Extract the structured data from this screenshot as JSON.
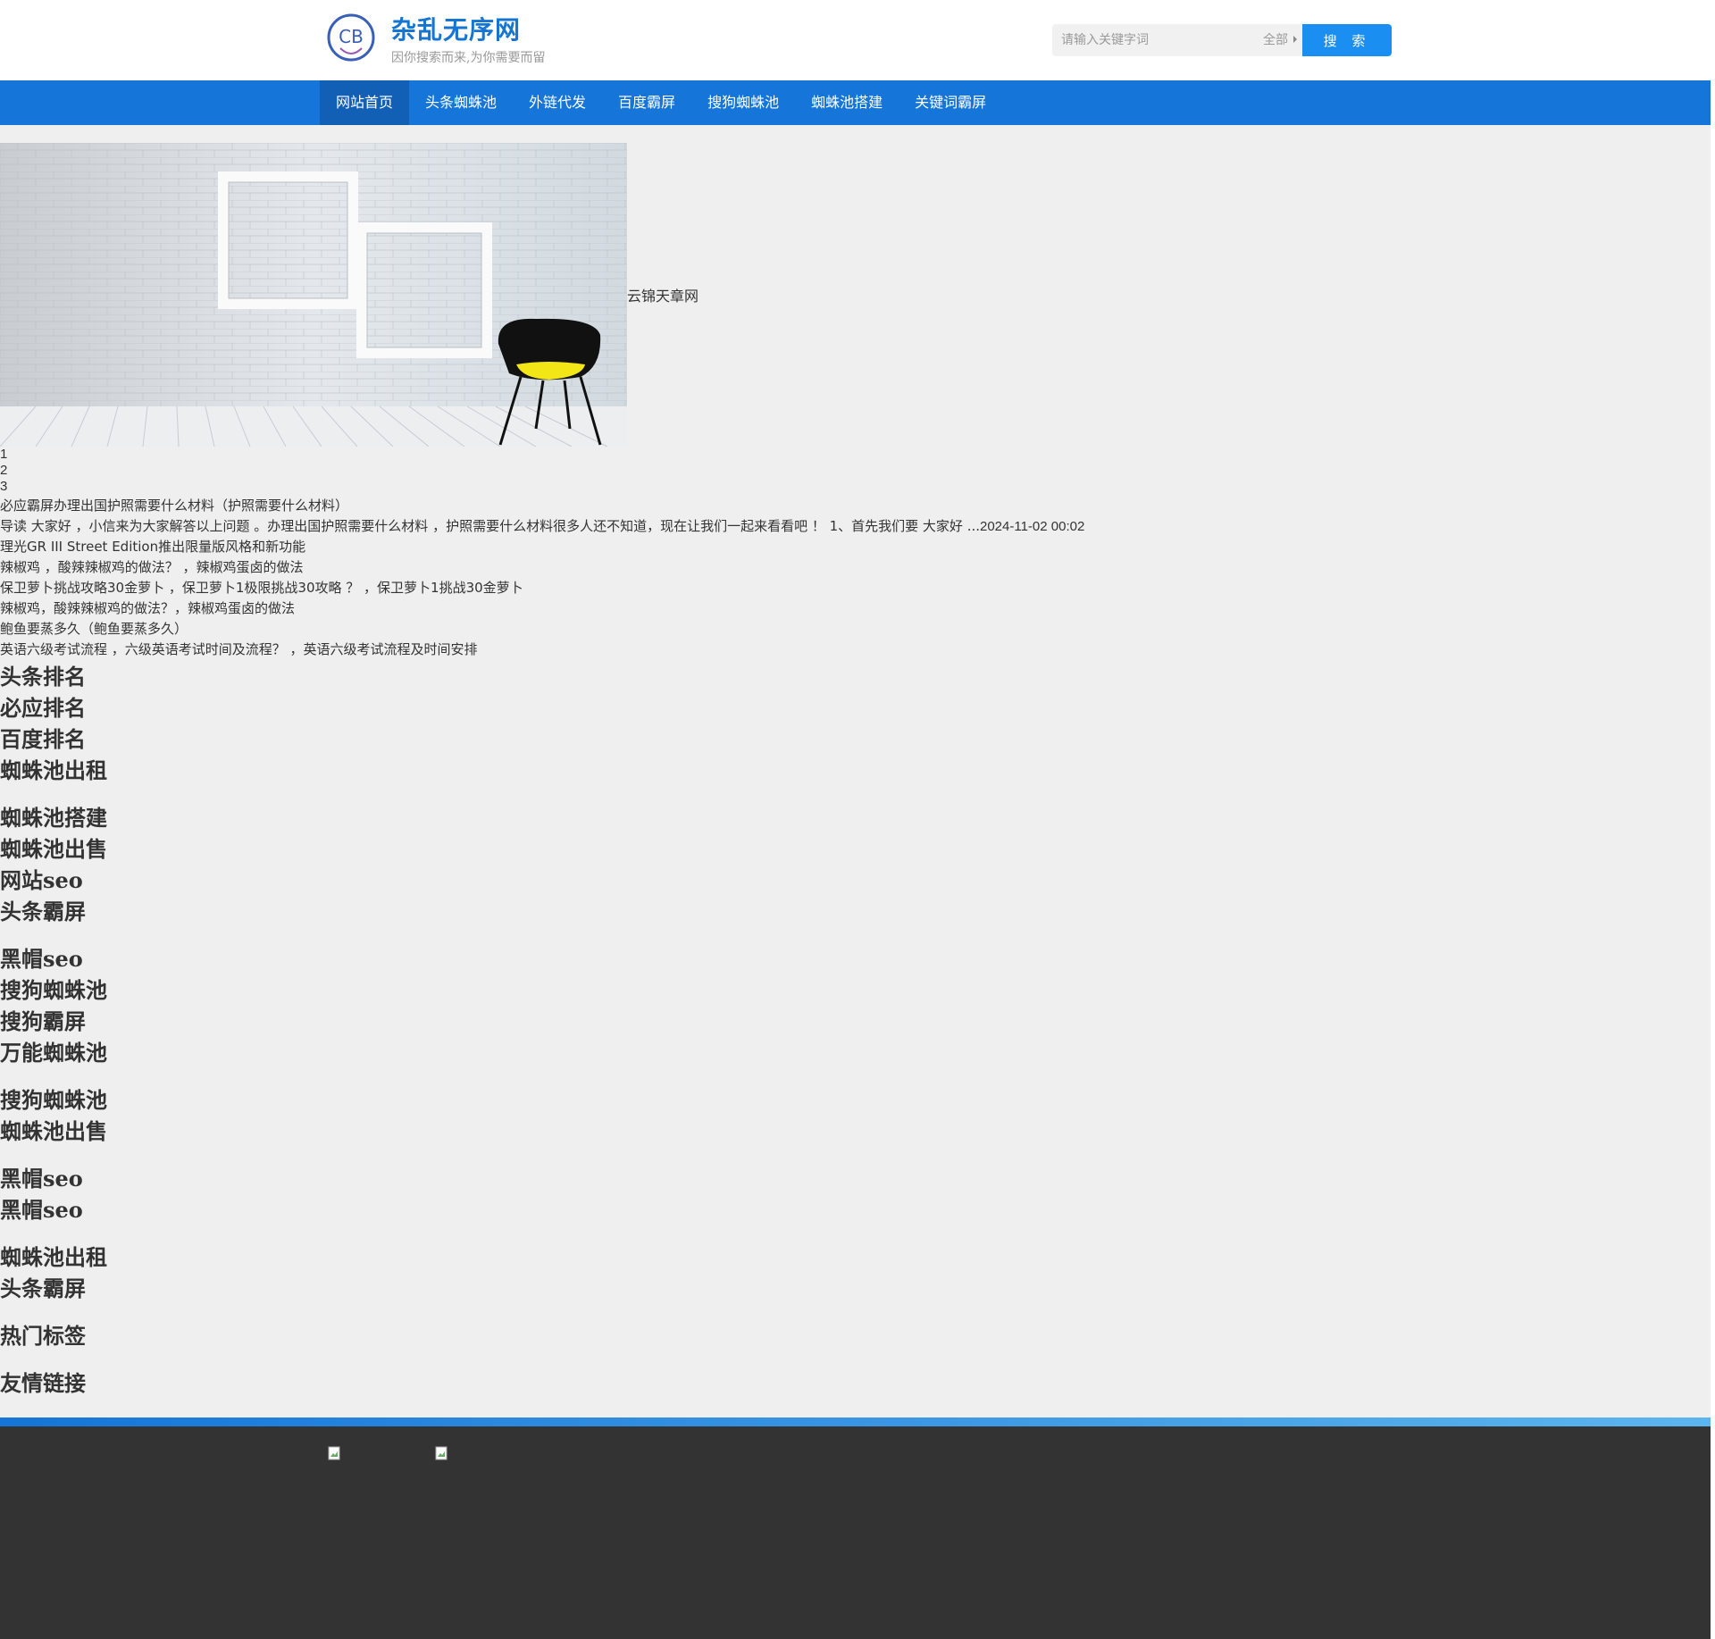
{
  "header": {
    "site_name": "杂乱无序网",
    "slogan": "因你搜索而来,为你需要而留",
    "search_placeholder": "请输入关键字词",
    "search_scope": "全部",
    "search_button": "搜 索",
    "logo_text": "CB"
  },
  "nav": {
    "items": [
      {
        "label": "网站首页",
        "active": true
      },
      {
        "label": "头条蜘蛛池"
      },
      {
        "label": "外链代发"
      },
      {
        "label": "百度霸屏"
      },
      {
        "label": "搜狗蜘蛛池"
      },
      {
        "label": "蜘蛛池搭建"
      },
      {
        "label": "关键词霸屏"
      }
    ]
  },
  "banner": {
    "caption": "云锦天章网"
  },
  "slider_dots": [
    "1",
    "2",
    "3"
  ],
  "articles": [
    {
      "text": "必应霸屏办理出国护照需要什么材料（护照需要什么材料）"
    },
    {
      "text": "导读 大家好  ，小信来为大家解答以上问题  。办理出国护照需要什么材料 ，护照需要什么材料很多人还不知道，现在让我们一起来看看吧  ！ 1、首先我们要 大家好 ...",
      "date": "2024-11-02 00:02"
    },
    {
      "text": "理光GR III Street Edition推出限量版风格和新功能"
    },
    {
      "text": "辣椒鸡 ，酸辣辣椒鸡的做法？  ，辣椒鸡蛋卤的做法"
    },
    {
      "text": "保卫萝卜挑战攻略30金萝卜 ，保卫萝卜1极限挑战30攻略 ？ ，保卫萝卜1挑战30金萝卜"
    },
    {
      "text": "辣椒鸡，酸辣辣椒鸡的做法？，辣椒鸡蛋卤的做法"
    },
    {
      "text": "鲍鱼要蒸多久（鲍鱼要蒸多久）"
    },
    {
      "text": "英语六级考试流程 ，六级英语考试时间及流程？ ，英语六级考试流程及时间安排"
    }
  ],
  "tag_headings": [
    {
      "label": "头条排名"
    },
    {
      "label": "必应排名"
    },
    {
      "label": "百度排名"
    },
    {
      "label": "蜘蛛池出租",
      "gap_after": true
    },
    {
      "label": "蜘蛛池搭建"
    },
    {
      "label": "蜘蛛池出售"
    },
    {
      "label": "网站seo"
    },
    {
      "label": "头条霸屏",
      "gap_after": true
    },
    {
      "label": "黑帽seo"
    },
    {
      "label": "搜狗蜘蛛池"
    },
    {
      "label": "搜狗霸屏"
    },
    {
      "label": "万能蜘蛛池",
      "gap_after": true
    },
    {
      "label": "搜狗蜘蛛池"
    },
    {
      "label": "蜘蛛池出售",
      "gap_after": true
    },
    {
      "label": "黑帽seo"
    },
    {
      "label": "黑帽seo",
      "gap_after": true
    },
    {
      "label": "蜘蛛池出租"
    },
    {
      "label": "头条霸屏",
      "gap_after": true
    },
    {
      "label": "热门标签",
      "gap_after": true
    },
    {
      "label": "友情链接"
    }
  ],
  "colors": {
    "brand_blue": "#1575d8",
    "nav_active": "#1160b6",
    "search_button": "#1b8ef2",
    "footer": "#333333"
  }
}
